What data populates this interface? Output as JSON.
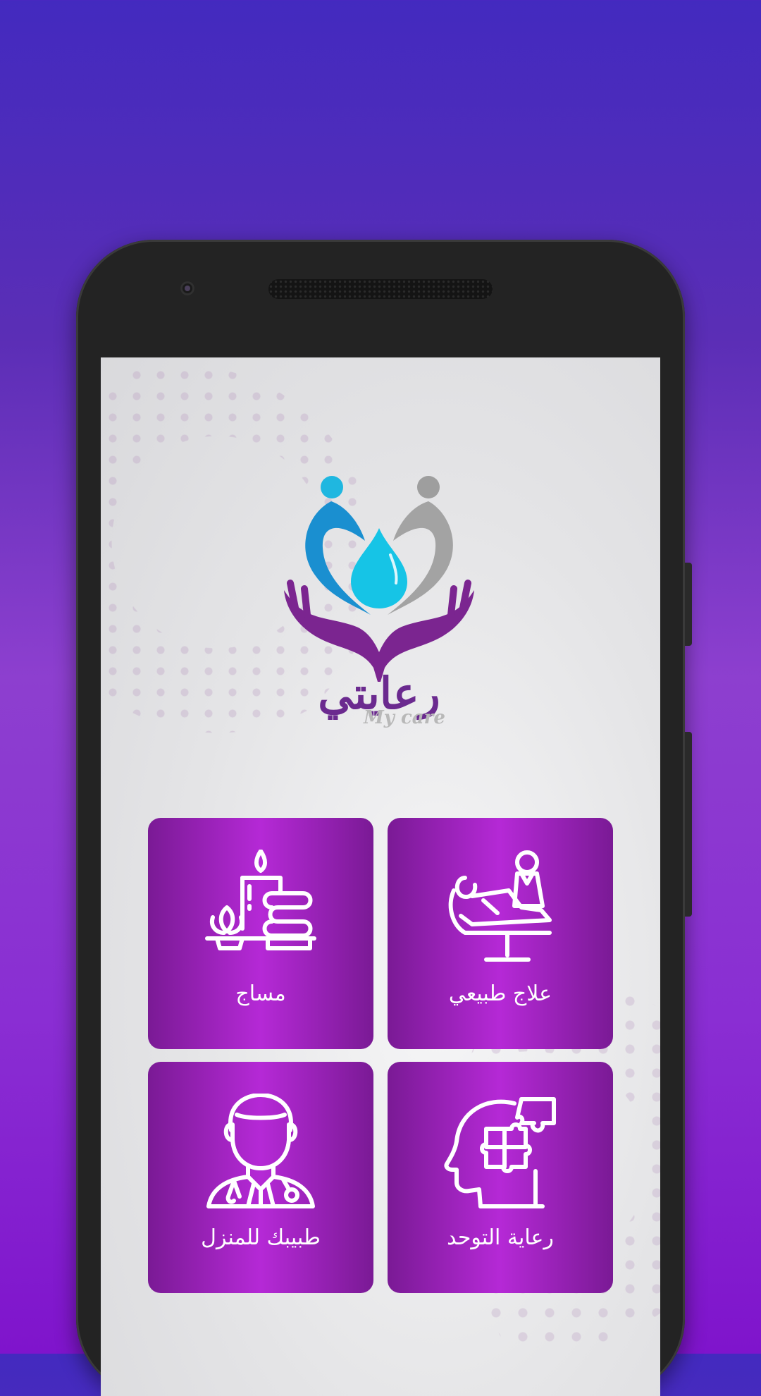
{
  "app": {
    "logo_arabic": "رعايتي",
    "logo_english": "My care"
  },
  "cards": [
    {
      "label": "علاج طبيعي",
      "icon": "physiotherapy-icon"
    },
    {
      "label": "مساج",
      "icon": "massage-spa-icon"
    },
    {
      "label": "رعاية التوحد",
      "icon": "autism-care-icon"
    },
    {
      "label": "طبيبك للمنزل",
      "icon": "home-doctor-icon"
    }
  ],
  "colors": {
    "background_top": "#432ABF",
    "background_bottom": "#7F14CC",
    "card_dark": "#7A1A95",
    "card_light": "#B529D6",
    "logo_blue": "#1FB7E0",
    "logo_gray": "#9E9E9E",
    "logo_purple": "#7B2590"
  }
}
